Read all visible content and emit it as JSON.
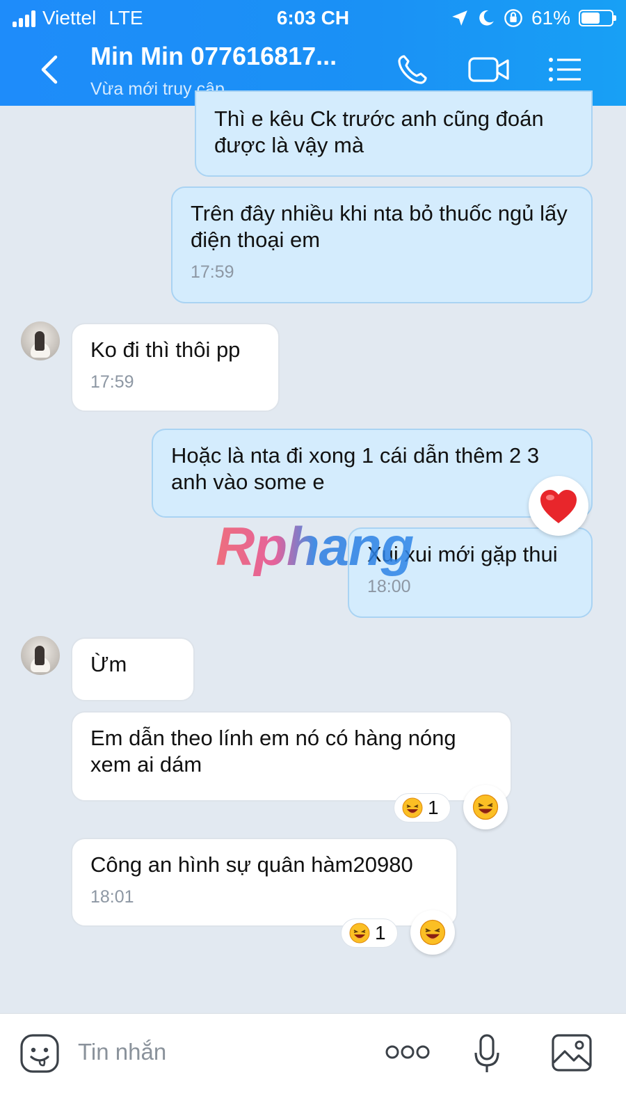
{
  "status_bar": {
    "carrier": "Viettel",
    "network": "LTE",
    "time": "6:03 CH",
    "battery": "61%",
    "battery_level": 0.61
  },
  "header": {
    "contact_name": "Min Min 077616817...",
    "status": "Vừa mới truy cập"
  },
  "messages": [
    {
      "side": "out",
      "text": "Thì e kêu Ck trước anh cũng đoán được là vậy mà",
      "time": ""
    },
    {
      "side": "out",
      "text": "Trên đây nhiều khi nta bỏ thuốc ngủ lấy điện thoại em",
      "time": "17:59"
    },
    {
      "side": "in",
      "text": "Ko đi thì thôi pp",
      "time": "17:59"
    },
    {
      "side": "out",
      "text": "Hoặc là nta đi xong 1 cái dẫn thêm 2 3 anh vào some e",
      "time": "",
      "reaction": "heart"
    },
    {
      "side": "out",
      "text": "Xui xui mới gặp thui",
      "time": "18:00"
    },
    {
      "side": "in",
      "text": "Ừm",
      "time": ""
    },
    {
      "side": "in",
      "text": "Em dẫn theo lính em nó có hàng nóng xem ai dám",
      "time": "",
      "reaction": "haha",
      "reaction_count": "1"
    },
    {
      "side": "in",
      "text": "Công an hình sự quân hàm20980",
      "time": "18:01",
      "reaction": "haha",
      "reaction_count": "1"
    }
  ],
  "watermark": "Rphang",
  "composer": {
    "placeholder": "Tin nhắn"
  },
  "icons": {
    "back": "chevron-left-icon",
    "call": "phone-icon",
    "video": "video-camera-icon",
    "menu": "list-menu-icon",
    "sticker": "emoji-face-icon",
    "more": "more-dots-icon",
    "mic": "microphone-icon",
    "image": "image-icon"
  },
  "colors": {
    "header": "#1e8cfa",
    "outgoing_bubble": "#d4ecfd",
    "incoming_bubble": "#ffffff",
    "background": "#e2e9f1",
    "heart": "#e8262b"
  }
}
